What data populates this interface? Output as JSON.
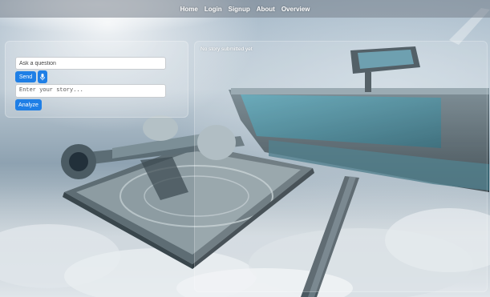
{
  "nav": {
    "links": [
      {
        "label": "Home"
      },
      {
        "label": "Login"
      },
      {
        "label": "Signup"
      },
      {
        "label": "About"
      },
      {
        "label": "Overview"
      }
    ]
  },
  "chat": {
    "question_placeholder": "Ask a question",
    "send_label": "Send",
    "mic_icon": "microphone-icon"
  },
  "story": {
    "placeholder": "Enter your story...",
    "analyze_label": "Analyze"
  },
  "result": {
    "text": "No story submitted yet"
  },
  "colors": {
    "accent": "#1f7fe6",
    "panel": "rgba(255,255,255,0.18)"
  }
}
